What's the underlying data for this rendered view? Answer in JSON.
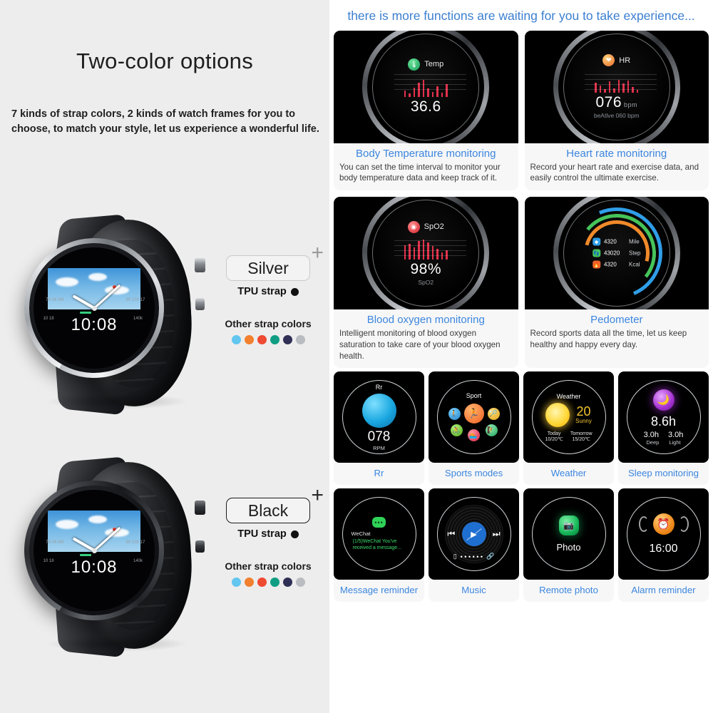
{
  "left_panel": {
    "title": "Two-color options",
    "subtitle": "7 kinds of strap colors, 2 kinds of watch frames for you to choose, to match your style, let us experience a wonderful life.",
    "swatch_colors": [
      "#63c6ef",
      "#f2802e",
      "#ef4a32",
      "#0f9e84",
      "#2f2f56",
      "#b9bdc1"
    ],
    "other_colors_label": "Other strap colors",
    "plus_symbol": "+",
    "options": [
      {
        "name": "Silver",
        "strap_label": "TPU strap",
        "strap_color": "#111111",
        "watch_time": "10:08",
        "subdials": [
          "76 04 AM",
          "60 100 17",
          "10 18",
          "140k"
        ]
      },
      {
        "name": "Black",
        "strap_label": "TPU strap",
        "strap_color": "#111111",
        "watch_time": "10:08",
        "subdials": [
          "76 04 AM",
          "60 100 17",
          "10 18",
          "140k"
        ]
      }
    ]
  },
  "right_panel": {
    "headline": "there is more functions are waiting for you to take experience...",
    "accent_color": "#3c86de",
    "feature_cards": [
      {
        "title": "Body Temperature monitoring",
        "description": "You can set the time interval to monitor your body temperature data and keep track of it.",
        "screen": {
          "icon": "thermometer-icon",
          "label": "Temp",
          "value": "36.6"
        }
      },
      {
        "title": "Heart rate monitoring",
        "description": "Record your heart rate and exercise data, and easily control the ultimate exercise.",
        "screen": {
          "icon": "heart-icon",
          "label": "HR",
          "value": "076",
          "unit": "bpm",
          "sub": "beAtlve 060 bpm"
        }
      },
      {
        "title": "Blood oxygen monitoring",
        "description": "Intelligent monitoring of blood oxygen saturation to take care of your blood oxygen health.",
        "screen": {
          "icon": "spo2-icon",
          "label": "SpO2",
          "value": "98%",
          "sub": "SpO2"
        }
      },
      {
        "title": "Pedometer",
        "description": "Record sports data all the time, let us keep healthy and happy every day.",
        "screen": {
          "rows": [
            {
              "icon": "location-icon",
              "value": "4320",
              "unit": "Mile",
              "color": "#2f9ee8"
            },
            {
              "icon": "footsteps-icon",
              "value": "43020",
              "unit": "Step",
              "color": "#46c45a"
            },
            {
              "icon": "flame-icon",
              "value": "4320",
              "unit": "Kcal",
              "color": "#f0642a"
            }
          ]
        }
      }
    ],
    "tiles": [
      {
        "caption": "Rr",
        "screen": {
          "label": "Rr",
          "value": "078",
          "unit": "RPM"
        }
      },
      {
        "caption": "Sports modes",
        "screen": {
          "label": "Sport"
        }
      },
      {
        "caption": "Weather",
        "screen": {
          "label": "Weather",
          "temp": "20",
          "condition": "Sunny",
          "today_label": "Today",
          "today_value": "10/20℃",
          "tomorrow_label": "Tomorrow",
          "tomorrow_value": "15/20℃"
        }
      },
      {
        "caption": "Sleep monitoring",
        "screen": {
          "total": "8.6h",
          "deep_value": "3.0h",
          "deep_label": "Deep",
          "light_value": "3.0h",
          "light_label": "Light"
        }
      },
      {
        "caption": "Message reminder",
        "screen": {
          "app": "WeChat",
          "message": "(1/5)WeChat  You've received a message..."
        }
      },
      {
        "caption": "Music",
        "screen": {
          "label": "Music"
        }
      },
      {
        "caption": "Remote photo",
        "screen": {
          "label": "Photo"
        }
      },
      {
        "caption": "Alarm reminder",
        "screen": {
          "value": "16:00"
        }
      }
    ]
  }
}
